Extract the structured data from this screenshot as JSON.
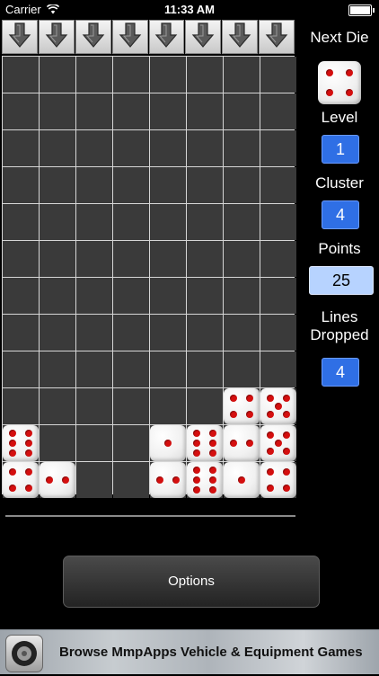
{
  "status_bar": {
    "carrier": "Carrier",
    "time": "11:33 AM"
  },
  "board": {
    "columns": 8,
    "rows": 12,
    "empty_color": "#3a3a3a",
    "pip_color": "#d40f0f",
    "dice": [
      {
        "row": 9,
        "col": 6,
        "value": 4
      },
      {
        "row": 9,
        "col": 7,
        "value": 5
      },
      {
        "row": 10,
        "col": 0,
        "value": 6
      },
      {
        "row": 10,
        "col": 4,
        "value": 1
      },
      {
        "row": 10,
        "col": 5,
        "value": 6
      },
      {
        "row": 10,
        "col": 6,
        "value": 2
      },
      {
        "row": 10,
        "col": 7,
        "value": 5
      },
      {
        "row": 11,
        "col": 0,
        "value": 4
      },
      {
        "row": 11,
        "col": 1,
        "value": 2
      },
      {
        "row": 11,
        "col": 4,
        "value": 2
      },
      {
        "row": 11,
        "col": 5,
        "value": 6
      },
      {
        "row": 11,
        "col": 6,
        "value": 1
      },
      {
        "row": 11,
        "col": 7,
        "value": 4
      }
    ]
  },
  "side_panel": {
    "next_die_label": "Next Die",
    "next_die_value": 4,
    "level_label": "Level",
    "level_value": "1",
    "cluster_label": "Cluster",
    "cluster_value": "4",
    "points_label": "Points",
    "points_value": "25",
    "lines_label_1": "Lines",
    "lines_label_2": "Dropped",
    "lines_value": "4"
  },
  "options_label": "Options",
  "ad": {
    "text": "Browse MmpApps Vehicle & Equipment Games",
    "icon": "tire-icon"
  }
}
